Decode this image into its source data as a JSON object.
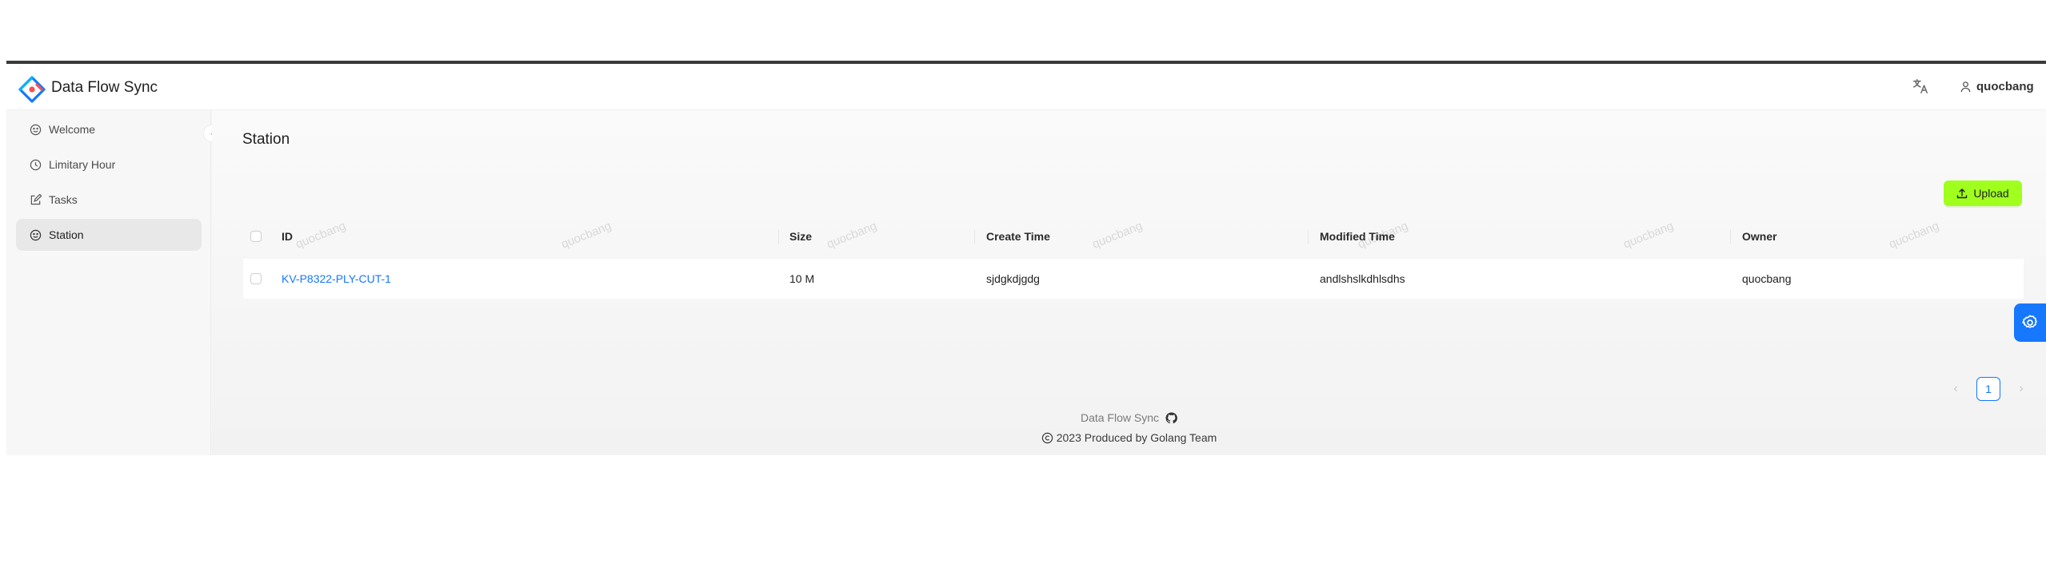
{
  "header": {
    "app_title": "Data Flow Sync",
    "language_icon": "translate-icon",
    "user_name": "quocbang"
  },
  "sidebar": {
    "items": [
      {
        "label": "Welcome",
        "icon": "smile-icon"
      },
      {
        "label": "Limitary Hour",
        "icon": "clock-icon"
      },
      {
        "label": "Tasks",
        "icon": "edit-icon"
      },
      {
        "label": "Station",
        "icon": "smile-icon"
      }
    ],
    "active": "Station"
  },
  "page": {
    "title": "Station",
    "upload_label": "Upload"
  },
  "table": {
    "columns": [
      "ID",
      "Size",
      "Create Time",
      "Modified Time",
      "Owner"
    ],
    "rows": [
      {
        "id": "KV-P8322-PLY-CUT-1",
        "size": "10 M",
        "create_time": "sjdgkdjgdg",
        "modified_time": "andlshslkdhlsdhs",
        "owner": "quocbang"
      }
    ]
  },
  "pagination": {
    "current_page": "1"
  },
  "watermark": "quocbang",
  "footer": {
    "line1": "Data Flow Sync",
    "line2": "2023 Produced by Golang Team"
  },
  "colors": {
    "accent": "#1677ff",
    "upload_button": "#a0ff1c"
  }
}
